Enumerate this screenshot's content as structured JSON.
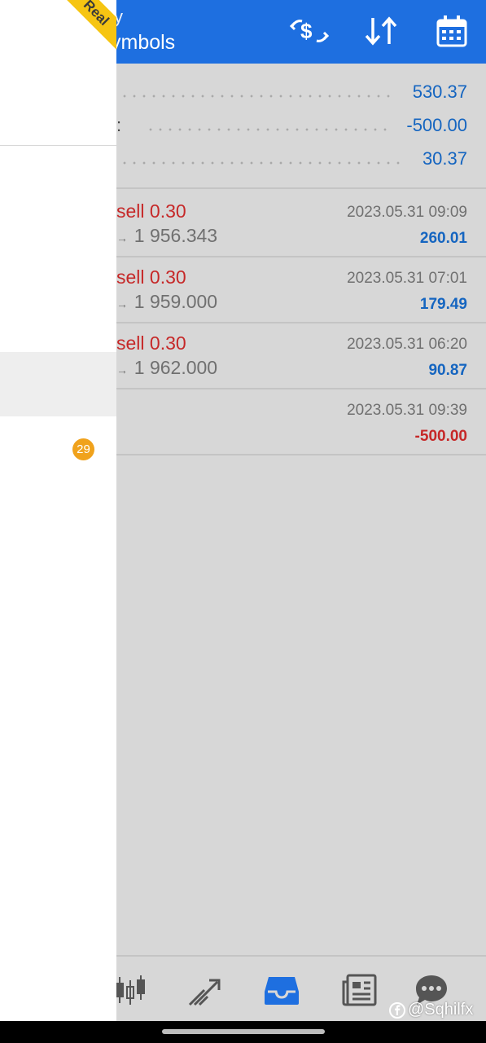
{
  "header": {
    "title_small": "y",
    "title_main": "ymbols",
    "icons": [
      "currency-exchange-icon",
      "sort-icon",
      "calendar-icon"
    ]
  },
  "summary": {
    "row1_value": "530.37",
    "row2_label": ":",
    "row2_value": "-500.00",
    "row3_value": "30.37"
  },
  "history": [
    {
      "type": "sell 0.30",
      "price": "1 956.343",
      "date": "2023.05.31 09:09",
      "profit": "260.01"
    },
    {
      "type": "sell 0.30",
      "price": "1 959.000",
      "date": "2023.05.31 07:01",
      "profit": "179.49"
    },
    {
      "type": "sell 0.30",
      "price": "1 962.000",
      "date": "2023.05.31 06:20",
      "profit": "90.87"
    },
    {
      "type": "",
      "price": "",
      "date": "2023.05.31 09:39",
      "profit": "-500.00"
    }
  ],
  "drawer": {
    "ribbon": "Real",
    "badge_count": "29"
  },
  "bottom_nav": [
    "chart-icon",
    "trade-icon",
    "history-icon",
    "news-icon",
    "chat-icon"
  ],
  "watermark": "@Sqhilfx",
  "colors": {
    "header": "#1e6fe0",
    "accent": "#1565c0",
    "negative": "#c62828",
    "badge": "#f0a21c",
    "ribbon": "#f6c512"
  }
}
